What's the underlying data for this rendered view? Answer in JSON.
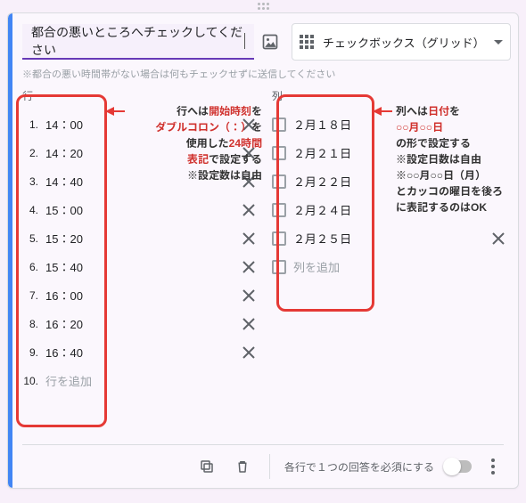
{
  "header": {
    "question_text": "都合の悪いところへチェックしてください",
    "type_label": "チェックボックス（グリッド）",
    "help_text": "※都合の悪い時間帯がない場合は何もチェックせずに送信してください"
  },
  "rows": {
    "title": "行",
    "items": [
      {
        "n": "1.",
        "label": "14：00"
      },
      {
        "n": "2.",
        "label": "14：20"
      },
      {
        "n": "3.",
        "label": "14：40"
      },
      {
        "n": "4.",
        "label": "15：00"
      },
      {
        "n": "5.",
        "label": "15：20"
      },
      {
        "n": "6.",
        "label": "15：40"
      },
      {
        "n": "7.",
        "label": "16：00"
      },
      {
        "n": "8.",
        "label": "16：20"
      },
      {
        "n": "9.",
        "label": "16：40"
      }
    ],
    "add": {
      "n": "10.",
      "label": "行を追加"
    }
  },
  "cols": {
    "title": "列",
    "items": [
      {
        "label": "２月１８日"
      },
      {
        "label": "２月２１日"
      },
      {
        "label": "２月２２日"
      },
      {
        "label": "２月２４日"
      },
      {
        "label": "２月２５日"
      }
    ],
    "add": {
      "label": "列を追加"
    }
  },
  "footer": {
    "require_label": "各行で１つの回答を必須にする"
  },
  "annotations": {
    "rows_note_1a": "行へは",
    "rows_note_1b": "開始時刻",
    "rows_note_1c": "を",
    "rows_note_2a": "ダブルコロン（：）",
    "rows_note_2b": "を",
    "rows_note_3a": "使用した",
    "rows_note_3b": "24時間",
    "rows_note_4": "表記",
    "rows_note_4b": "で設定する",
    "rows_note_5": "※設定数は自由",
    "cols_note_1a": "列へは",
    "cols_note_1b": "日付",
    "cols_note_1c": "を",
    "cols_note_2": "○○月○○日",
    "cols_note_3": "の形で設定する",
    "cols_note_4": "※設定日数は自由",
    "cols_note_5": "※○○月○○日（月）",
    "cols_note_6": "とカッコの曜日を後ろ",
    "cols_note_7": "に表記するのはOK"
  }
}
